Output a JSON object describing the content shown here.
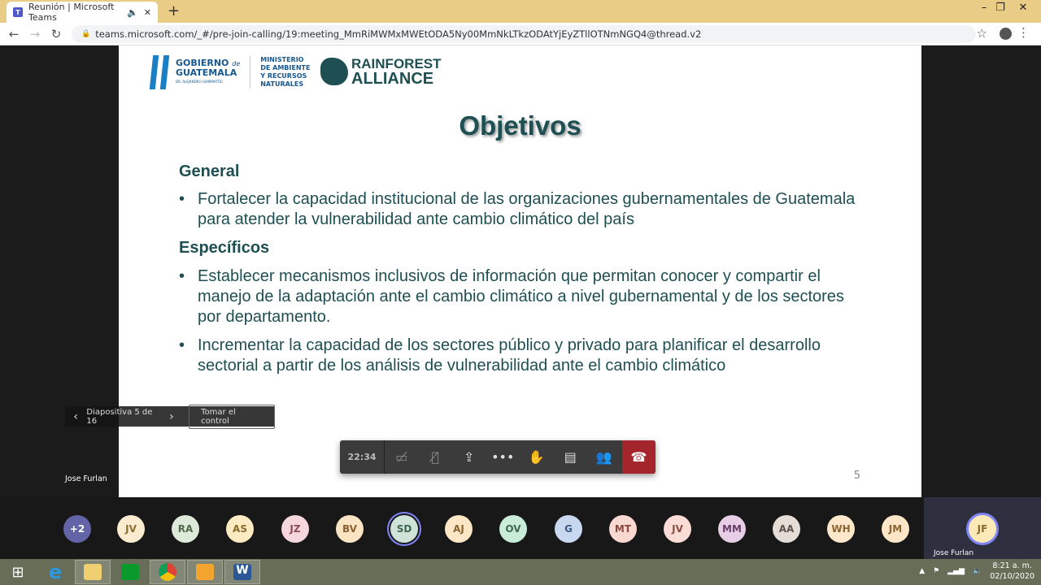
{
  "browser": {
    "tab_title": "Reunión | Microsoft Teams",
    "new_tab": "+",
    "url": "teams.microsoft.com/_#/pre-join-calling/19:meeting_MmRiMWMxMWEtODA5Ny00MmNkLTkzODAtYjEyZTllOTNmNGQ4@thread.v2"
  },
  "slide": {
    "logo_gobierno": "GOBIERNO de GUATEMALA",
    "logo_gobierno_sub": "DR. ALEJANDRO GIAMMATTEI",
    "logo_ministerio": [
      "MINISTERIO",
      "DE AMBIENTE",
      "Y RECURSOS",
      "NATURALES"
    ],
    "logo_rainforest": [
      "RAINFOREST",
      "ALLIANCE"
    ],
    "title": "Objetivos",
    "general_heading": "General",
    "general_bullets": [
      "Fortalecer la capacidad institucional de las organizaciones gubernamentales de Guatemala para atender la vulnerabilidad ante cambio climático del país"
    ],
    "specific_heading": "Específicos",
    "specific_bullets": [
      "Establecer mecanismos inclusivos de información que permitan conocer y compartir el manejo de la adaptación ante el cambio climático a nivel gubernamental y de los sectores por departamento.",
      "Incrementar la capacidad de los sectores público y privado para planificar el desarrollo sectorial a partir de los análisis de vulnerabilidad ante el cambio climático"
    ],
    "page_number": "5"
  },
  "slide_nav": {
    "label": "Diapositiva 5 de 16",
    "take_control": "Tomar el control"
  },
  "presenter": "Jose Furlan",
  "call": {
    "timer": "22:34",
    "icons": [
      "camera-off-icon",
      "mic-off-icon",
      "share-screen-icon",
      "more-icon",
      "raise-hand-icon",
      "chat-icon",
      "participants-icon",
      "hang-up-icon"
    ],
    "hangup_color": "#a4262c"
  },
  "participants": [
    {
      "initials": "+2",
      "bg": "#6264a7",
      "fg": "#ffffff"
    },
    {
      "initials": "JV",
      "bg": "#fbecd0",
      "fg": "#8a6d2f"
    },
    {
      "initials": "RA",
      "bg": "#dde9d9",
      "fg": "#4f6a4a"
    },
    {
      "initials": "AS",
      "bg": "#fcebc2",
      "fg": "#8a6a2a"
    },
    {
      "initials": "JZ",
      "bg": "#f5d6dc",
      "fg": "#8a4a58"
    },
    {
      "initials": "BV",
      "bg": "#fbe4c4",
      "fg": "#8a6030"
    },
    {
      "initials": "SD",
      "bg": "#cfe3d8",
      "fg": "#3e6652",
      "ring": true
    },
    {
      "initials": "AJ",
      "bg": "#fbe6c6",
      "fg": "#8a6530"
    },
    {
      "initials": "OV",
      "bg": "#c9ecd9",
      "fg": "#3e6a52"
    },
    {
      "initials": "G",
      "bg": "#c8d8ee",
      "fg": "#3e5a84"
    },
    {
      "initials": "MT",
      "bg": "#fad8d2",
      "fg": "#8a4a40"
    },
    {
      "initials": "JV",
      "bg": "#fbdcd6",
      "fg": "#8a4e44"
    },
    {
      "initials": "MM",
      "bg": "#e6cfe6",
      "fg": "#6a3e6a"
    },
    {
      "initials": "AA",
      "bg": "#e6dcd6",
      "fg": "#5e524a"
    },
    {
      "initials": "WH",
      "bg": "#fde8cc",
      "fg": "#8a6430"
    },
    {
      "initials": "JM",
      "bg": "#fde6c8",
      "fg": "#8a6230"
    }
  ],
  "self": {
    "initials": "JF",
    "name": "Jose Furlan"
  },
  "taskbar": {
    "apps": [
      "start-icon",
      "ie-icon",
      "file-explorer-icon",
      "store-icon",
      "chrome-icon",
      "outlook-icon",
      "word-icon"
    ],
    "time": "8:21 a. m.",
    "date": "02/10/2020"
  }
}
